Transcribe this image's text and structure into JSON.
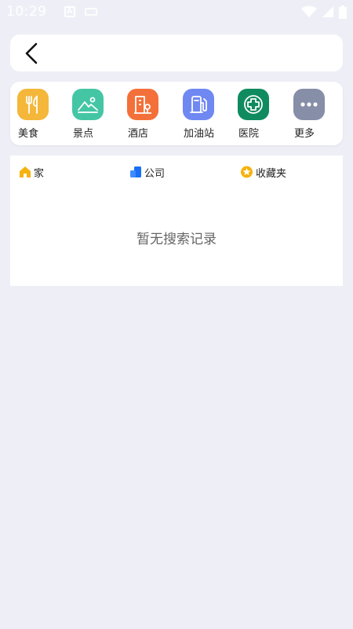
{
  "status_bar": {
    "time": "10:29"
  },
  "categories": [
    {
      "label": "美食",
      "icon": "food-icon",
      "color": "#f4b73a"
    },
    {
      "label": "景点",
      "icon": "scenic-icon",
      "color": "#44c6a5"
    },
    {
      "label": "酒店",
      "icon": "hotel-icon",
      "color": "#f4703a"
    },
    {
      "label": "加油站",
      "icon": "gas-station-icon",
      "color": "#6f88f2"
    },
    {
      "label": "医院",
      "icon": "hospital-icon",
      "color": "#0f8b5f"
    },
    {
      "label": "更多",
      "icon": "more-icon",
      "color": "#868ea8"
    }
  ],
  "quick_places": [
    {
      "label": "家",
      "icon": "home-icon",
      "color": "#f6b20f"
    },
    {
      "label": "公司",
      "icon": "company-icon",
      "color": "#1a6ff5"
    },
    {
      "label": "收藏夹",
      "icon": "star-icon",
      "color": "#f6b20f"
    }
  ],
  "history": {
    "empty_text": "暂无搜索记录"
  },
  "colors": {
    "background": "#eeeff6",
    "card": "#ffffff"
  }
}
